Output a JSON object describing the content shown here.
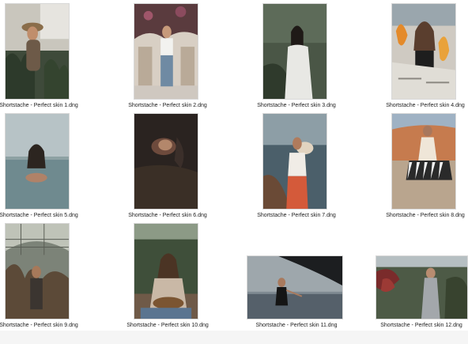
{
  "files": [
    {
      "name": "Shortstache - Perfect skin 1.dng",
      "thumb_icon": "photo-thumbnail-icon"
    },
    {
      "name": "Shortstache - Perfect skin 2.dng",
      "thumb_icon": "photo-thumbnail-icon"
    },
    {
      "name": "Shortstache - Perfect skin 3.dng",
      "thumb_icon": "photo-thumbnail-icon"
    },
    {
      "name": "Shortstache - Perfect skin 4.dng",
      "thumb_icon": "photo-thumbnail-icon"
    },
    {
      "name": "Shortstache - Perfect skin 5.dng",
      "thumb_icon": "photo-thumbnail-icon"
    },
    {
      "name": "Shortstache - Perfect skin 6.dng",
      "thumb_icon": "photo-thumbnail-icon"
    },
    {
      "name": "Shortstache - Perfect skin 7.dng",
      "thumb_icon": "photo-thumbnail-icon"
    },
    {
      "name": "Shortstache - Perfect skin 8.dng",
      "thumb_icon": "photo-thumbnail-icon"
    },
    {
      "name": "Shortstache - Perfect skin 9.dng",
      "thumb_icon": "photo-thumbnail-icon"
    },
    {
      "name": "Shortstache - Perfect skin 10.dng",
      "thumb_icon": "photo-thumbnail-icon"
    },
    {
      "name": "Shortstache - Perfect skin 11.dng",
      "thumb_icon": "photo-thumbnail-icon"
    },
    {
      "name": "Shortstache - Perfect skin 12.dng",
      "thumb_icon": "photo-thumbnail-icon"
    }
  ]
}
